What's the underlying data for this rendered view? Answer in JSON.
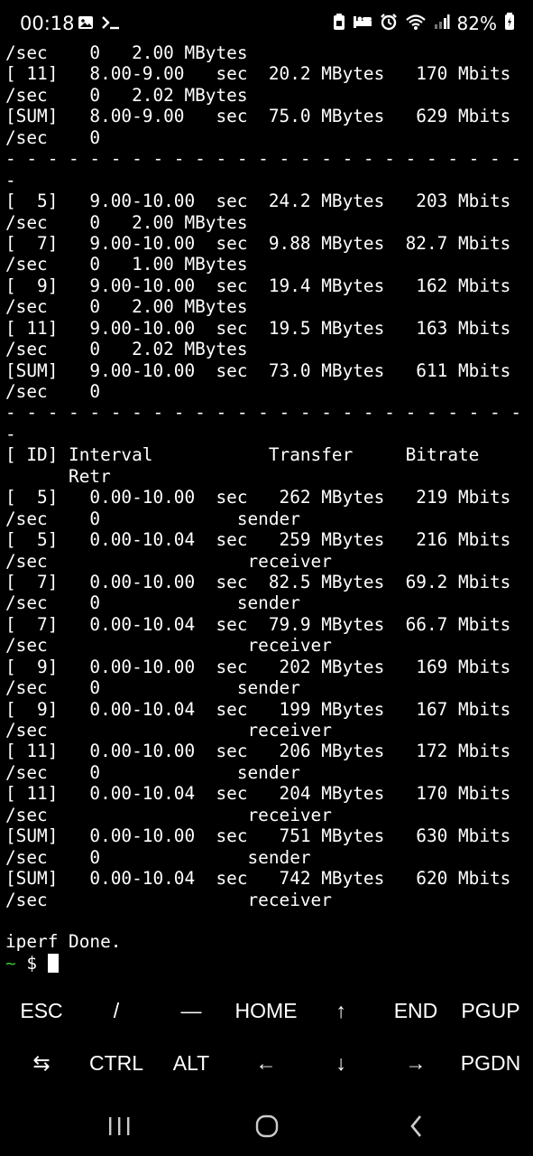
{
  "status_bar": {
    "time": "00:18",
    "battery": "82%",
    "left_icons": [
      "image-icon",
      "terminal-prompt-icon"
    ],
    "right_icons": [
      "clipboard-icon",
      "sleep-icon",
      "alarm-icon",
      "wifi-icon",
      "signal-icon",
      "battery-icon"
    ]
  },
  "terminal": {
    "lines": [
      "/sec    0   2.00 MBytes",
      "[ 11]   8.00-9.00   sec  20.2 MBytes   170 Mbits",
      "/sec    0   2.02 MBytes",
      "[SUM]   8.00-9.00   sec  75.0 MBytes   629 Mbits",
      "/sec    0",
      "- - - - - - - - - - - - - - - - - - - - - - - - -",
      "-",
      "[  5]   9.00-10.00  sec  24.2 MBytes   203 Mbits",
      "/sec    0   2.00 MBytes",
      "[  7]   9.00-10.00  sec  9.88 MBytes  82.7 Mbits",
      "/sec    0   1.00 MBytes",
      "[  9]   9.00-10.00  sec  19.4 MBytes   162 Mbits",
      "/sec    0   2.00 MBytes",
      "[ 11]   9.00-10.00  sec  19.5 MBytes   163 Mbits",
      "/sec    0   2.02 MBytes",
      "[SUM]   9.00-10.00  sec  73.0 MBytes   611 Mbits",
      "/sec    0",
      "- - - - - - - - - - - - - - - - - - - - - - - - -",
      "-",
      "[ ID] Interval           Transfer     Bitrate",
      "      Retr",
      "[  5]   0.00-10.00  sec   262 MBytes   219 Mbits",
      "/sec    0             sender",
      "[  5]   0.00-10.04  sec   259 MBytes   216 Mbits",
      "/sec                   receiver",
      "[  7]   0.00-10.00  sec  82.5 MBytes  69.2 Mbits",
      "/sec    0             sender",
      "[  7]   0.00-10.04  sec  79.9 MBytes  66.7 Mbits",
      "/sec                   receiver",
      "[  9]   0.00-10.00  sec   202 MBytes   169 Mbits",
      "/sec    0             sender",
      "[  9]   0.00-10.04  sec   199 MBytes   167 Mbits",
      "/sec                   receiver",
      "[ 11]   0.00-10.00  sec   206 MBytes   172 Mbits",
      "/sec    0             sender",
      "[ 11]   0.00-10.04  sec   204 MBytes   170 Mbits",
      "/sec                   receiver",
      "[SUM]   0.00-10.00  sec   751 MBytes   630 Mbits",
      "/sec    0              sender",
      "[SUM]   0.00-10.04  sec   742 MBytes   620 Mbits",
      "/sec                   receiver",
      "",
      "iperf Done."
    ],
    "prompt_tilde": "~",
    "prompt_symbol": " $ "
  },
  "extra_keys": {
    "row1": [
      {
        "label": "ESC",
        "name": "esc-key"
      },
      {
        "label": "/",
        "name": "slash-key"
      },
      {
        "label": "—",
        "name": "dash-key"
      },
      {
        "label": "HOME",
        "name": "home-key"
      },
      {
        "label": "↑",
        "name": "up-arrow-key"
      },
      {
        "label": "END",
        "name": "end-key"
      },
      {
        "label": "PGUP",
        "name": "pgup-key"
      }
    ],
    "row2": [
      {
        "label": "⇆",
        "name": "tab-key"
      },
      {
        "label": "CTRL",
        "name": "ctrl-key"
      },
      {
        "label": "ALT",
        "name": "alt-key"
      },
      {
        "label": "←",
        "name": "left-arrow-key"
      },
      {
        "label": "↓",
        "name": "down-arrow-key"
      },
      {
        "label": "→",
        "name": "right-arrow-key"
      },
      {
        "label": "PGDN",
        "name": "pgdn-key"
      }
    ]
  },
  "nav_bar": {
    "buttons": [
      "recent-apps-icon",
      "home-icon",
      "back-icon"
    ]
  },
  "colors": {
    "background": "#000000",
    "text": "#ffffff",
    "prompt_tilde": "#36c236"
  }
}
